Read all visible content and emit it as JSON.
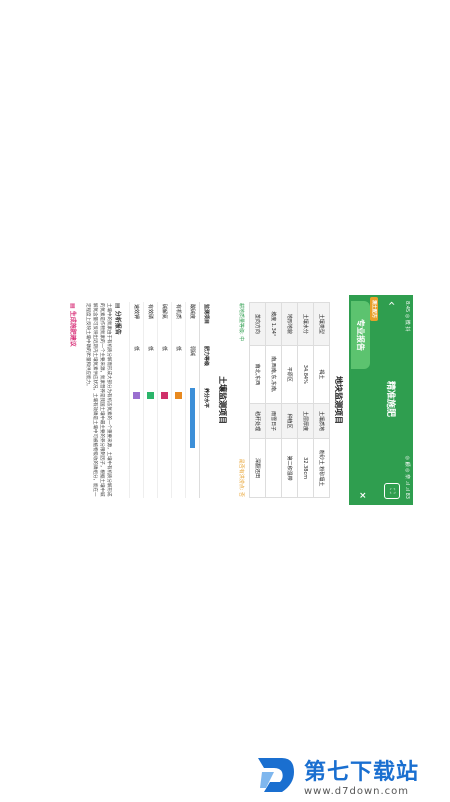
{
  "status_bar": {
    "left": "8:45 ◎ 微 抖",
    "right": "◎ 顧 ◎ 奈 .ıl .ıl 83"
  },
  "nav": {
    "title": "精准施肥"
  },
  "tabs": {
    "active": "专业报告",
    "badge": "测土配方"
  },
  "plot_section": {
    "title": "地块监测项目",
    "rows": [
      {
        "k1": "土壤类型",
        "v1": "褐土",
        "k2": "土壤质地",
        "v2": "粉砂土 粉砂壤土"
      },
      {
        "k1": "土壤水分",
        "v1": "34.84%",
        "k2": "土层厚度",
        "v2": "32.38cm"
      },
      {
        "k1": "地形地貌",
        "v1": "平原区",
        "k2": "种植区",
        "v2": "第二积温带"
      },
      {
        "k1": "坡度 1.34°",
        "v1": "南,西南,东,东南,",
        "k2": "雨雪日子",
        "v2": ""
      },
      {
        "k1": "垄向方向",
        "v1": "南北,东西",
        "k2": "秸秆处理",
        "v2": "深翻还田"
      }
    ],
    "hint_left": "耕地质量等级: 中",
    "hint_right": "是否有洪涝点: 否"
  },
  "soil_section": {
    "title": "土壤监测项目",
    "headers": [
      "监测项目",
      "肥力等级",
      "养分水平"
    ],
    "rows": [
      {
        "item": "酸碱度",
        "level": "弱碱",
        "color": "#3c8fd8",
        "bar": true
      },
      {
        "item": "有机质",
        "level": "低",
        "color": "#e8891f",
        "bar": false
      },
      {
        "item": "碱解氮",
        "level": "低",
        "color": "#d0306a",
        "bar": false
      },
      {
        "item": "有效磷",
        "level": "低",
        "color": "#2bb56a",
        "bar": false
      },
      {
        "item": "速效钾",
        "level": "低",
        "color": "#9a6fd0",
        "bar": false
      }
    ]
  },
  "analysis": {
    "title": "分析报告",
    "text": "土壤中的氮素由于有机质分解而形成大部分为有机态氮素的一个重要来源，土壤中有机质分解形成的氮素是作物氮素的一个主要来源，氮素营养是我国土壤中最主要的养分限制因子，根据土壤中碱解氮含量可反映出近期内土壤氮素供应状况，土壤有效磷是土壤中可被植物吸收的磷组分，能在一定程度上反映土壤中磷的贮量和供应能力。"
  },
  "generate_link": "生成施肥建议",
  "watermark": {
    "brand": "第七下载站",
    "url": "www.d7down.com",
    "color": "#1a6fd0"
  }
}
